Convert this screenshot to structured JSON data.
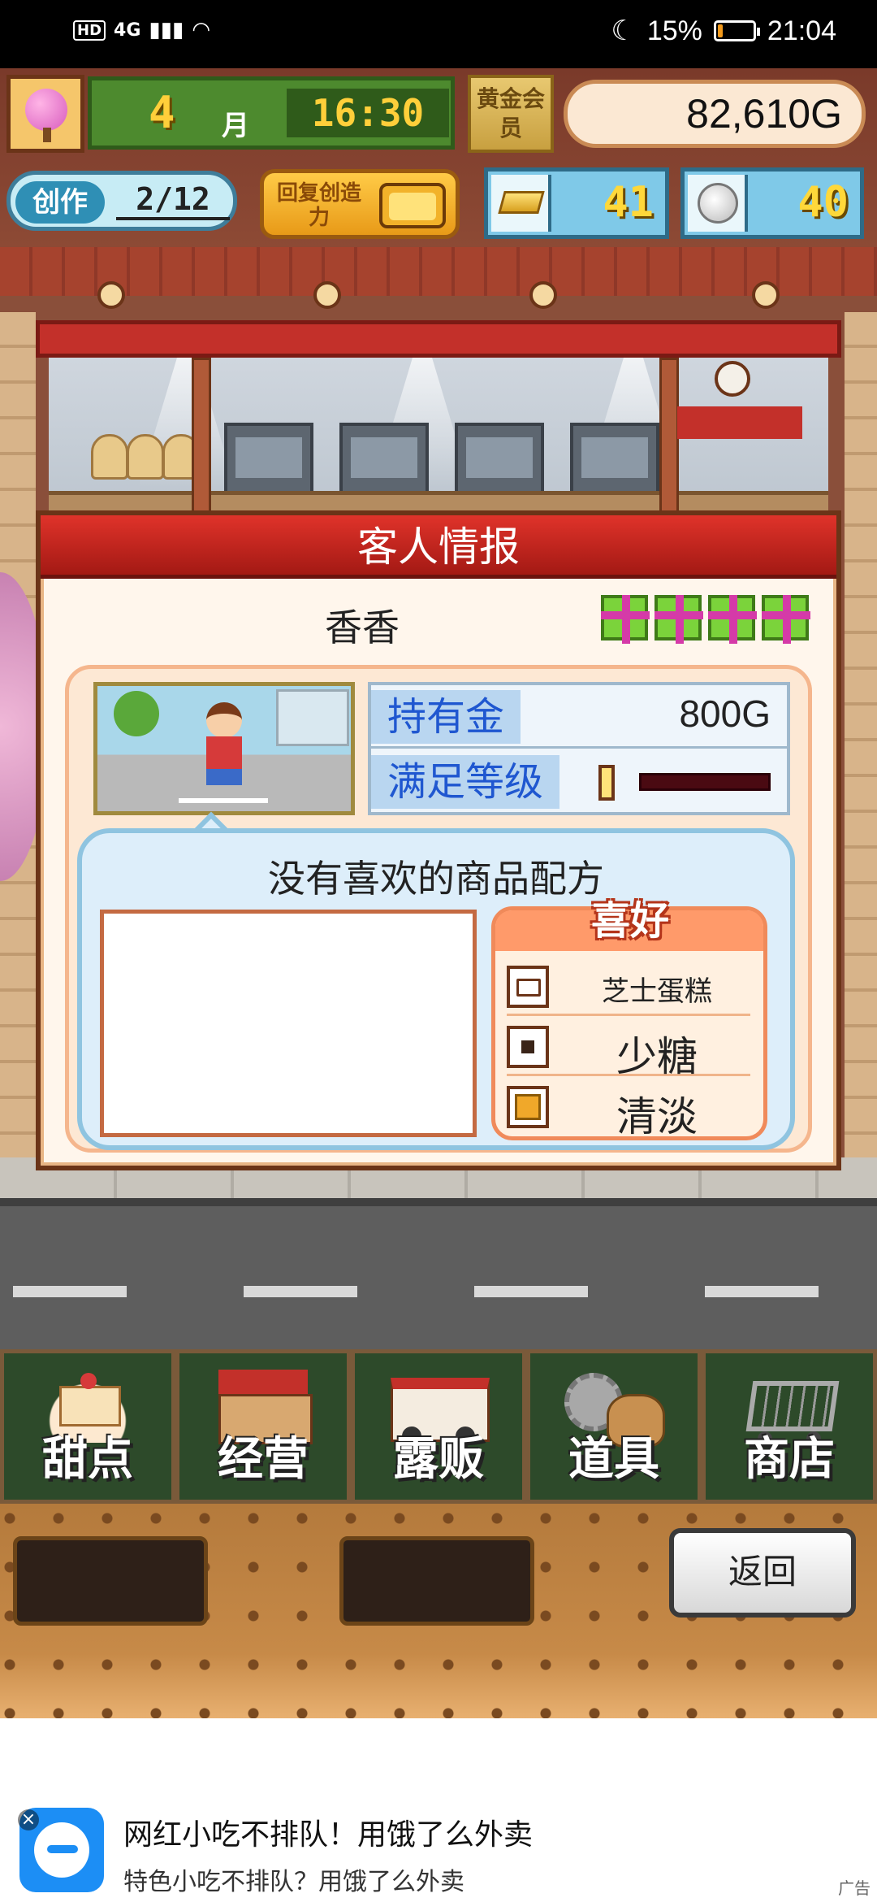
{
  "status_bar": {
    "hd": "HD",
    "network": "4G",
    "battery_percent": "15%",
    "battery_level": 0.15,
    "time": "21:04"
  },
  "hud": {
    "month": "4",
    "month_label": "月",
    "clock": "16:30",
    "gold_member": "黄金会员",
    "money": "82,610G",
    "create_label": "创作",
    "create_count": "2/12",
    "recover_label": "回复创造力",
    "gold_bars": "41",
    "silver_coins": "40"
  },
  "dialog": {
    "title": "客人情报",
    "customer_name": "香香",
    "gift_count": 4,
    "money_label": "持有金",
    "money_value": "800G",
    "satisfaction_label": "满足等级",
    "satisfaction_level": 0.0,
    "no_recipe_text": "没有喜欢的商品配方",
    "prefs_title": "喜好",
    "prefs": [
      {
        "icon": "folder-icon",
        "text": "芝士蛋糕"
      },
      {
        "icon": "square-icon",
        "text": "少糖"
      },
      {
        "icon": "cube-icon",
        "text": "清淡"
      }
    ]
  },
  "menu": {
    "items": [
      {
        "label": "甜点",
        "icon": "cake-icon"
      },
      {
        "label": "经营",
        "icon": "shop-icon"
      },
      {
        "label": "露贩",
        "icon": "truck-icon"
      },
      {
        "label": "道具",
        "icon": "tools-icon"
      },
      {
        "label": "商店",
        "icon": "cart-icon"
      }
    ],
    "back_label": "返回"
  },
  "ad": {
    "title": "网红小吃不排队！用饿了么外卖",
    "subtitle": "特色小吃不排队？用饿了么外卖",
    "tag": "广告"
  },
  "colors": {
    "dialog_header": "#c3241d",
    "stat_key_text": "#1f57d0",
    "gift_green": "#7bd33b"
  }
}
